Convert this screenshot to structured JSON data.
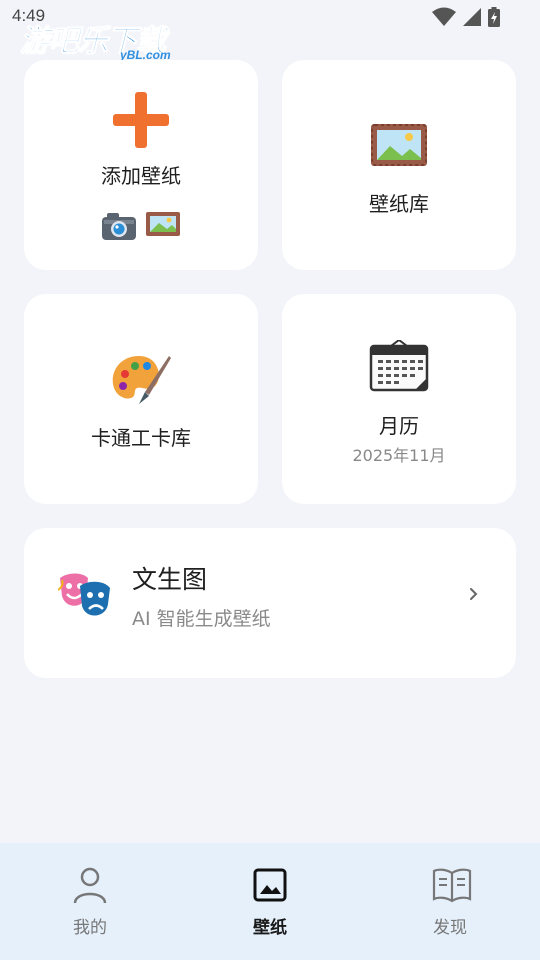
{
  "status": {
    "time": "4:49"
  },
  "watermark": {
    "main": "游吧乐下载",
    "sub": "yBL.com"
  },
  "cards": {
    "add": {
      "title": "添加壁纸",
      "icon": "plus-icon",
      "sub_icons": [
        "camera-icon",
        "framed-picture-icon"
      ]
    },
    "library": {
      "title": "壁纸库",
      "icon": "framed-picture-icon"
    },
    "cartoon": {
      "title": "卡通工卡库",
      "icon": "palette-icon"
    },
    "calendar": {
      "title": "月历",
      "subtitle": "2025年11月",
      "icon": "calendar-icon"
    }
  },
  "ai_card": {
    "title": "文生图",
    "subtitle": "AI 智能生成壁纸",
    "icon": "theater-masks-icon",
    "chevron": "chevron-right-icon"
  },
  "bottom_nav": {
    "items": [
      {
        "label": "我的",
        "icon": "person-icon",
        "active": false
      },
      {
        "label": "壁纸",
        "icon": "image-icon",
        "active": true
      },
      {
        "label": "发现",
        "icon": "book-icon",
        "active": false
      }
    ]
  },
  "colors": {
    "background": "#f3f4f9",
    "card": "#ffffff",
    "accent_orange": "#f07030",
    "nav_bg": "#e5f0fb",
    "text_secondary": "#888888"
  }
}
